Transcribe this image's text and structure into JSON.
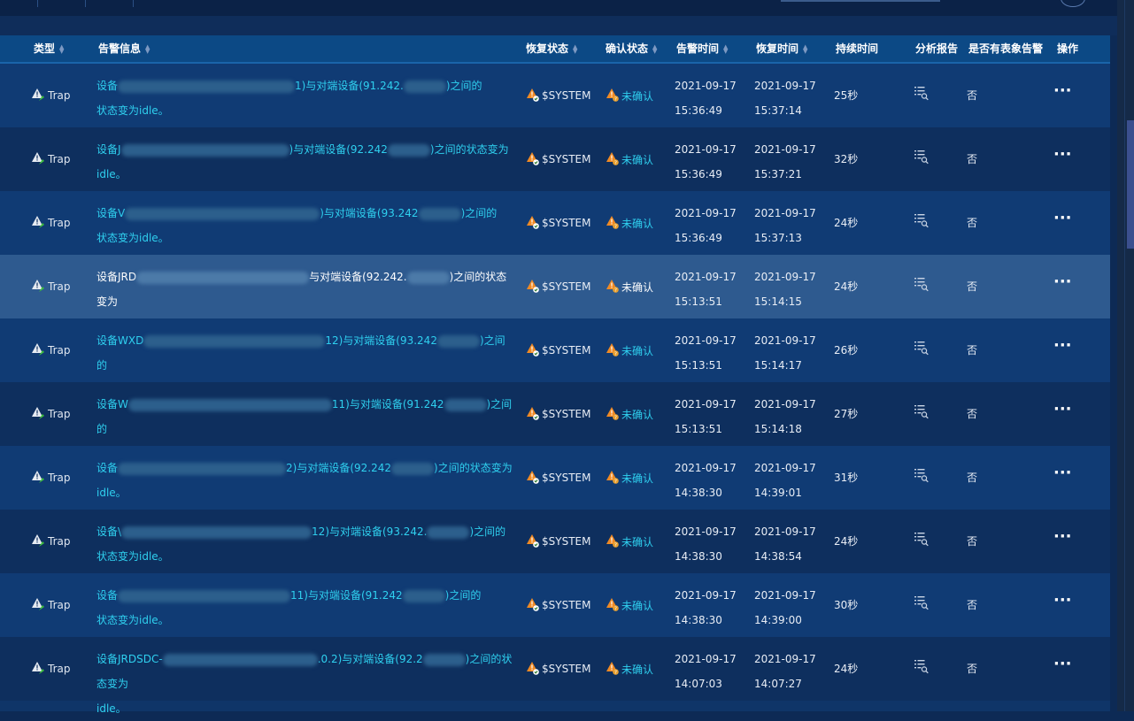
{
  "columns": [
    {
      "label": "类型",
      "sortable": true
    },
    {
      "label": "告警信息",
      "sortable": true
    },
    {
      "label": "恢复状态",
      "sortable": true
    },
    {
      "label": "确认状态",
      "sortable": true
    },
    {
      "label": "告警时间",
      "sortable": true
    },
    {
      "label": "恢复时间",
      "sortable": true
    },
    {
      "label": "持续时间",
      "sortable": false
    },
    {
      "label": "分析报告",
      "sortable": false
    },
    {
      "label": "是否有表象告警",
      "sortable": false
    },
    {
      "label": "操作",
      "sortable": false
    }
  ],
  "rows": [
    {
      "type": "Trap",
      "msg_a": "设备",
      "msg_b": "1)与对端设备(91.242.",
      "msg_c": ")之间的",
      "msg_d": "状态变为idle。",
      "recover": "$SYSTEM",
      "confirm": "未确认",
      "alarm_date": "2021-09-17",
      "alarm_time": "15:36:49",
      "recover_date": "2021-09-17",
      "recover_time": "15:37:14",
      "duration": "25秒",
      "apparent": "否"
    },
    {
      "type": "Trap",
      "msg_a": "设备J",
      "msg_b": ")与对端设备(92.242",
      "msg_c": ")之间的状态变为",
      "msg_d": "idle。",
      "recover": "$SYSTEM",
      "confirm": "未确认",
      "alarm_date": "2021-09-17",
      "alarm_time": "15:36:49",
      "recover_date": "2021-09-17",
      "recover_time": "15:37:21",
      "duration": "32秒",
      "apparent": "否"
    },
    {
      "type": "Trap",
      "msg_a": "设备V",
      "msg_b": ")与对端设备(93.242",
      "msg_c": ")之间的",
      "msg_d": "状态变为idle。",
      "recover": "$SYSTEM",
      "confirm": "未确认",
      "alarm_date": "2021-09-17",
      "alarm_time": "15:36:49",
      "recover_date": "2021-09-17",
      "recover_time": "15:37:13",
      "duration": "24秒",
      "apparent": "否"
    },
    {
      "type": "Trap",
      "msg_a": "设备JRD",
      "msg_b": "与对端设备(92.242.",
      "msg_c": ")之间的状态变为",
      "msg_d": "idle。",
      "recover": "$SYSTEM",
      "confirm": "未确认",
      "alarm_date": "2021-09-17",
      "alarm_time": "15:13:51",
      "recover_date": "2021-09-17",
      "recover_time": "15:14:15",
      "duration": "24秒",
      "apparent": "否"
    },
    {
      "type": "Trap",
      "msg_a": "设备WXD",
      "msg_b": "12)与对端设备(93.242",
      "msg_c": ")之间的",
      "msg_d": "状态变为idle。",
      "recover": "$SYSTEM",
      "confirm": "未确认",
      "alarm_date": "2021-09-17",
      "alarm_time": "15:13:51",
      "recover_date": "2021-09-17",
      "recover_time": "15:14:17",
      "duration": "26秒",
      "apparent": "否"
    },
    {
      "type": "Trap",
      "msg_a": "设备W",
      "msg_b": "11)与对端设备(91.242",
      "msg_c": ")之间的",
      "msg_d": "状态变为idle。",
      "recover": "$SYSTEM",
      "confirm": "未确认",
      "alarm_date": "2021-09-17",
      "alarm_time": "15:13:51",
      "recover_date": "2021-09-17",
      "recover_time": "15:14:18",
      "duration": "27秒",
      "apparent": "否"
    },
    {
      "type": "Trap",
      "msg_a": "设备",
      "msg_b": "2)与对端设备(92.242",
      "msg_c": ")之间的状态变为",
      "msg_d": "idle。",
      "recover": "$SYSTEM",
      "confirm": "未确认",
      "alarm_date": "2021-09-17",
      "alarm_time": "14:38:30",
      "recover_date": "2021-09-17",
      "recover_time": "14:39:01",
      "duration": "31秒",
      "apparent": "否"
    },
    {
      "type": "Trap",
      "msg_a": "设备\\",
      "msg_b": "12)与对端设备(93.242.",
      "msg_c": ")之间的",
      "msg_d": "状态变为idle。",
      "recover": "$SYSTEM",
      "confirm": "未确认",
      "alarm_date": "2021-09-17",
      "alarm_time": "14:38:30",
      "recover_date": "2021-09-17",
      "recover_time": "14:38:54",
      "duration": "24秒",
      "apparent": "否"
    },
    {
      "type": "Trap",
      "msg_a": "设备",
      "msg_b": "11)与对端设备(91.242",
      "msg_c": ")之间的",
      "msg_d": "状态变为idle。",
      "recover": "$SYSTEM",
      "confirm": "未确认",
      "alarm_date": "2021-09-17",
      "alarm_time": "14:38:30",
      "recover_date": "2021-09-17",
      "recover_time": "14:39:00",
      "duration": "30秒",
      "apparent": "否"
    },
    {
      "type": "Trap",
      "msg_a": "设备JRDSDC-",
      "msg_b": ".0.2)与对端设备(92.2",
      "msg_c": ")之间的状态变为",
      "msg_d": "idle。",
      "recover": "$SYSTEM",
      "confirm": "未确认",
      "alarm_date": "2021-09-17",
      "alarm_time": "14:07:03",
      "recover_date": "2021-09-17",
      "recover_time": "14:07:27",
      "duration": "24秒",
      "apparent": "否"
    }
  ],
  "highlighted_row": 3,
  "colors": {
    "accent_text": "#2fd0ef",
    "header_bg": "#0c4985",
    "warn": "#f08a24"
  },
  "icons": {
    "type": "trap-alert-icon",
    "recover": "warning-check-icon",
    "confirm": "warning-question-icon",
    "report": "report-search-icon",
    "actions": "more-icon"
  }
}
